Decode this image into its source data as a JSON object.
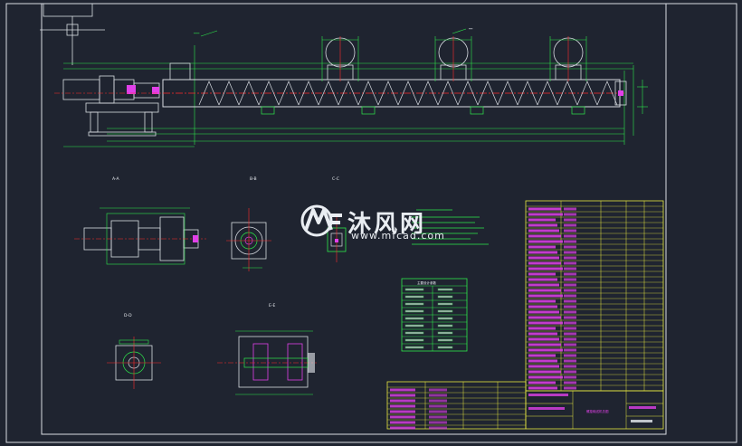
{
  "watermark": {
    "brand": "沐风网",
    "url": "www.mfcad.com"
  },
  "drawing": {
    "views": {
      "a_a": "A-A",
      "b_b": "B-B",
      "c_c": "C-C",
      "d_d": "D-D",
      "e_e": "E-E"
    },
    "table_title": "主要设计参数",
    "title_block_name": "螺旋输送机总图"
  },
  "colors": {
    "background": "#1f2430",
    "frame": "#d8dce2",
    "green": "#2ee84a",
    "red": "#ff2a2a",
    "magenta": "#e040e8",
    "yellow": "#e6e640",
    "white": "#e9edf2",
    "cyan": "#3ad8e8"
  }
}
